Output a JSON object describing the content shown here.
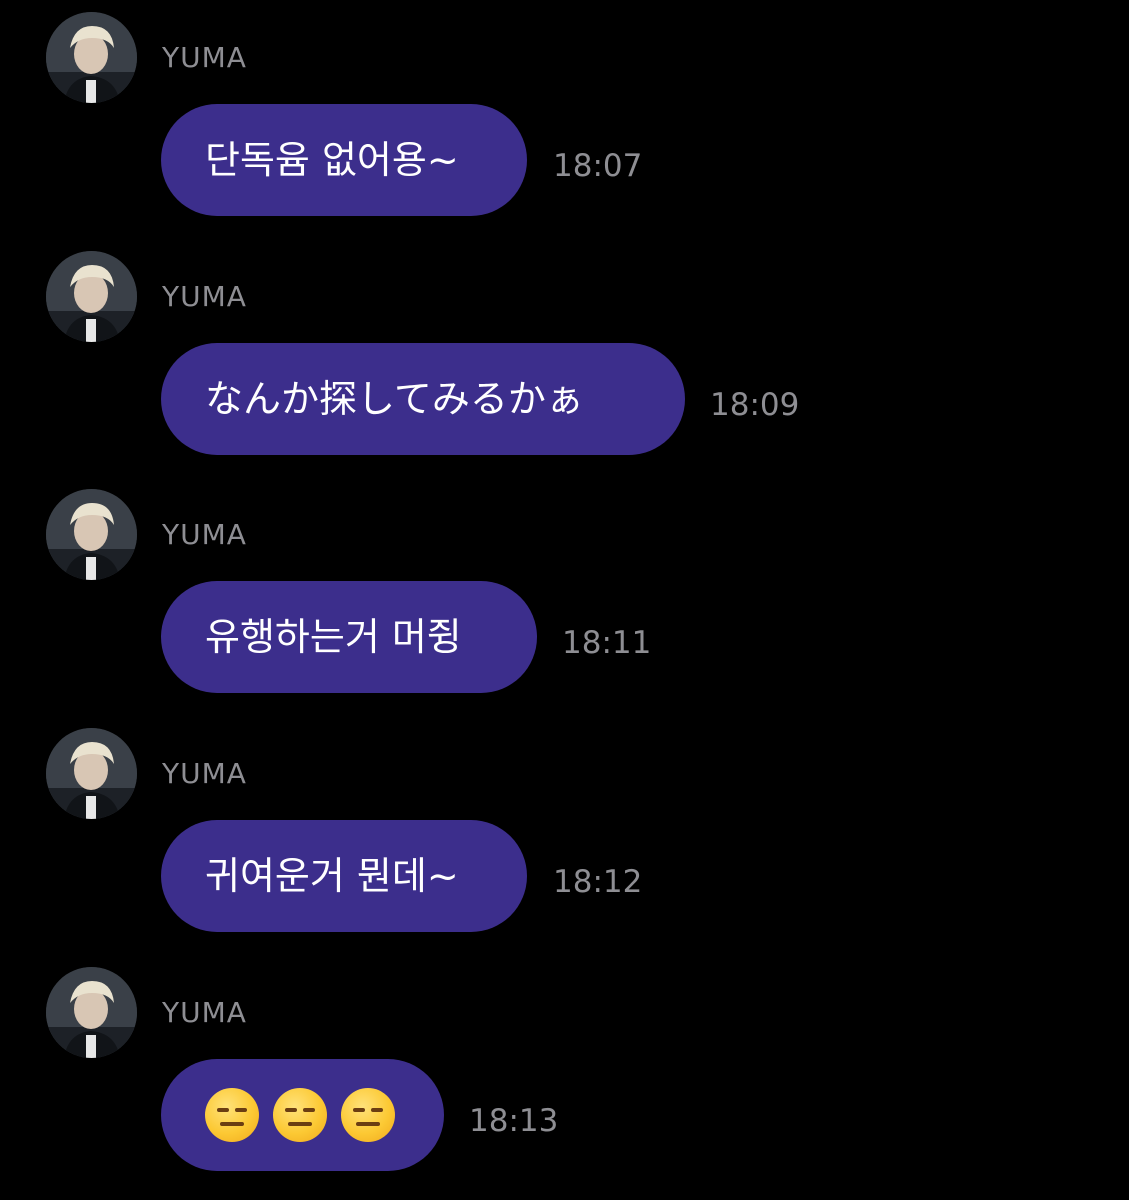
{
  "colors": {
    "background": "#000000",
    "bubble": "#3c2e8c",
    "bubble_text": "#ffffff",
    "meta_text": "#8e8e93"
  },
  "messages": [
    {
      "sender": "YUMA",
      "text": "단독윰 없어용~",
      "time": "18:07",
      "avatar_icon": "profile-photo"
    },
    {
      "sender": "YUMA",
      "text": "なんか探してみるかぁ",
      "time": "18:09",
      "avatar_icon": "profile-photo"
    },
    {
      "sender": "YUMA",
      "text": "유행하는거 머쥥",
      "time": "18:11",
      "avatar_icon": "profile-photo"
    },
    {
      "sender": "YUMA",
      "text": "귀여운거 뭔데~",
      "time": "18:12",
      "avatar_icon": "profile-photo"
    },
    {
      "sender": "YUMA",
      "text": "😑😑😑",
      "emoji": [
        "expressionless-face-emoji",
        "expressionless-face-emoji",
        "expressionless-face-emoji"
      ],
      "time": "18:13",
      "avatar_icon": "profile-photo"
    }
  ]
}
